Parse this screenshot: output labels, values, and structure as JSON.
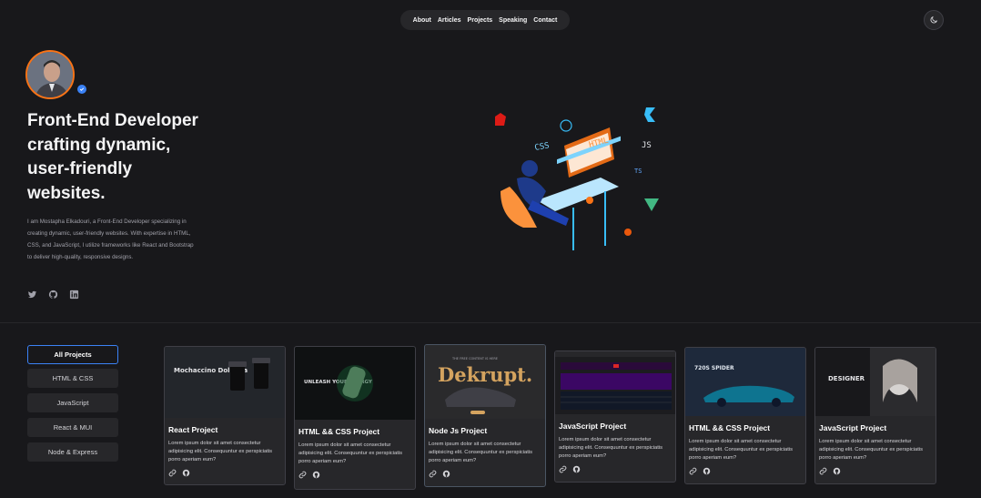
{
  "nav": {
    "items": [
      "About",
      "Articles",
      "Projects",
      "Speaking",
      "Contact"
    ]
  },
  "theme_toggle": {
    "icon": "moon-icon"
  },
  "hero": {
    "headline": "Front-End Developer crafting dynamic, user-friendly websites.",
    "bio": "I am Mostapha Elkadouri, a Front-End Developer specializing in creating dynamic, user-friendly websites. With expertise in HTML, CSS, and JavaScript, I utilize frameworks like React and Bootstrap to deliver high-quality, responsive designs.",
    "socials": [
      "twitter-icon",
      "github-icon",
      "linkedin-icon"
    ]
  },
  "illustration": {
    "tags": [
      "HTML",
      "CSS",
      "JS",
      "TS"
    ]
  },
  "filters": [
    "All Projects",
    "HTML & CSS",
    "JavaScript",
    "React & MUI",
    "Node & Express"
  ],
  "filters_active": "All Projects",
  "projects": [
    {
      "title": "React Project",
      "thumb_text": "Mochaccino Dolgona",
      "description": "Lorem ipsum dolor sit amet consectetur adipisicing elit. Consequuntur ex perspiciatis porro aperiam eum?"
    },
    {
      "title": "HTML && CSS Project",
      "thumb_text": "UNLEASH YOUR ENERGY",
      "description": "Lorem ipsum dolor sit amet consectetur adipisicing elit. Consequuntur ex perspiciatis porro aperiam eum?"
    },
    {
      "title": "Node Js Project",
      "thumb_text": "Dekrupt.",
      "thumb_sub": "THE FREE CONTENT IS HERE",
      "description": "Lorem ipsum dolor sit amet consectetur adipisicing elit. Consequuntur ex perspiciatis porro aperiam eum?"
    },
    {
      "title": "JavaScript Project",
      "thumb_text": "",
      "description": "Lorem ipsum dolor sit amet consectetur adipisicing elit. Consequuntur ex perspiciatis porro aperiam eum?"
    },
    {
      "title": "HTML && CSS Project",
      "thumb_text": "720S SPIDER",
      "description": "Lorem ipsum dolor sit amet consectetur adipisicing elit. Consequuntur ex perspiciatis porro aperiam eum?"
    },
    {
      "title": "JavaScript Project",
      "thumb_text": "DESIGNER",
      "description": "Lorem ipsum dolor sit amet consectetur adipisicing elit. Consequuntur ex perspiciatis porro aperiam eum?"
    }
  ],
  "colors": {
    "accent": "#3b82f6",
    "avatar_ring": "#f97316",
    "background": "#18181b",
    "card": "#27272a"
  }
}
